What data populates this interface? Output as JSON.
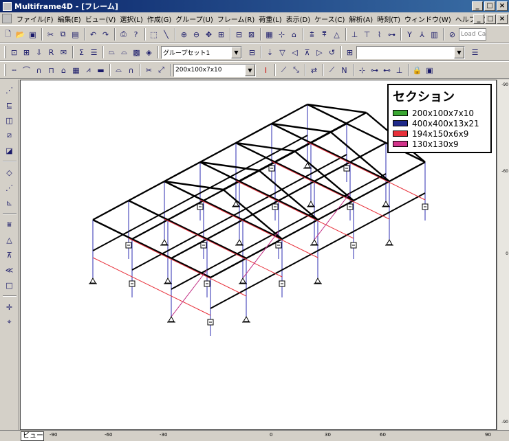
{
  "window": {
    "title": "Multiframe4D - [フレーム]",
    "controls": [
      "_",
      "□",
      "×"
    ]
  },
  "menu": [
    "ファイル(F)",
    "編集(E)",
    "ビュー(V)",
    "選択(L)",
    "作成(G)",
    "グループ(U)",
    "フレーム(R)",
    "荷重(L)",
    "表示(D)",
    "ケース(C)",
    "解析(A)",
    "時刻(T)",
    "ウィンドウ(W)",
    "ヘルプ(H)"
  ],
  "toolbar": {
    "load_case_placeholder": "Load Cas",
    "group_combo": "グループセット1",
    "section_combo": "200x100x7x10"
  },
  "legend": {
    "title": "セクション",
    "items": [
      {
        "label": "200x100x7x10",
        "color": "#3aa832"
      },
      {
        "label": "400x400x13x21",
        "color": "#1f2a8a"
      },
      {
        "label": "194x150x6x9",
        "color": "#e8303a"
      },
      {
        "label": "130x130x9",
        "color": "#d2338a"
      }
    ]
  },
  "view_tab": "ビュー",
  "ruler": [
    "-90",
    "-60",
    "-30",
    "0",
    "30",
    "60",
    "90"
  ],
  "vruler": [
    "-90",
    "-60",
    "0",
    "-90"
  ]
}
